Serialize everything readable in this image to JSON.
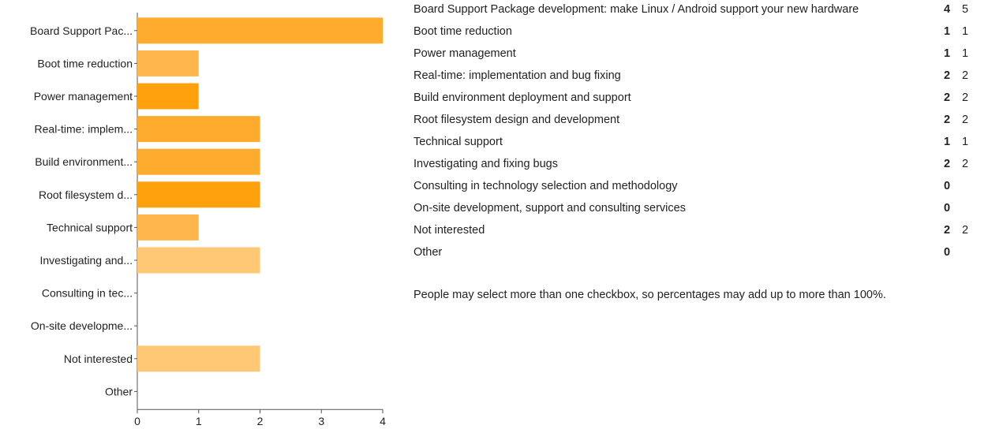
{
  "chart_data": {
    "type": "bar",
    "orientation": "horizontal",
    "categories": [
      "Board Support Pac...",
      "Boot time reduction",
      "Power management",
      "Real-time: implem...",
      "Build environment...",
      "Root filesystem d...",
      "Technical support",
      "Investigating and...",
      "Consulting in tec...",
      "On-site developme...",
      "Not interested",
      "Other"
    ],
    "values": [
      4,
      1,
      1,
      2,
      2,
      2,
      1,
      2,
      0,
      0,
      2,
      0
    ],
    "colors": [
      "#ffab2e",
      "#ffb74d",
      "#ffa00d",
      "#ffab2e",
      "#ffab2e",
      "#ffa00d",
      "#ffb74d",
      "#ffc875",
      "#ffc875",
      "#ffc875",
      "#ffc875",
      "#ffc875"
    ],
    "xticks": [
      "0",
      "1",
      "2",
      "3",
      "4"
    ],
    "xlim": [
      0,
      4
    ],
    "grid": false,
    "title": "",
    "xlabel": "",
    "ylabel": ""
  },
  "results": [
    {
      "question": "Board Support Package development: make Linux / Android support your new hardware",
      "count": "4",
      "percent": "5"
    },
    {
      "question": "Boot time reduction",
      "count": "1",
      "percent": "1"
    },
    {
      "question": "Power management",
      "count": "1",
      "percent": "1"
    },
    {
      "question": "Real-time: implementation and bug fixing",
      "count": "2",
      "percent": "2"
    },
    {
      "question": "Build environment deployment and support",
      "count": "2",
      "percent": "2"
    },
    {
      "question": "Root filesystem design and development",
      "count": "2",
      "percent": "2"
    },
    {
      "question": "Technical support",
      "count": "1",
      "percent": "1"
    },
    {
      "question": "Investigating and fixing bugs",
      "count": "2",
      "percent": "2"
    },
    {
      "question": "Consulting in technology selection and methodology",
      "count": "0",
      "percent": ""
    },
    {
      "question": "On-site development, support and consulting services",
      "count": "0",
      "percent": ""
    },
    {
      "question": "Not interested",
      "count": "2",
      "percent": "2"
    },
    {
      "question": "Other",
      "count": "0",
      "percent": ""
    }
  ],
  "footnote": "People may select more than one checkbox, so percentages may add up to more than 100%."
}
